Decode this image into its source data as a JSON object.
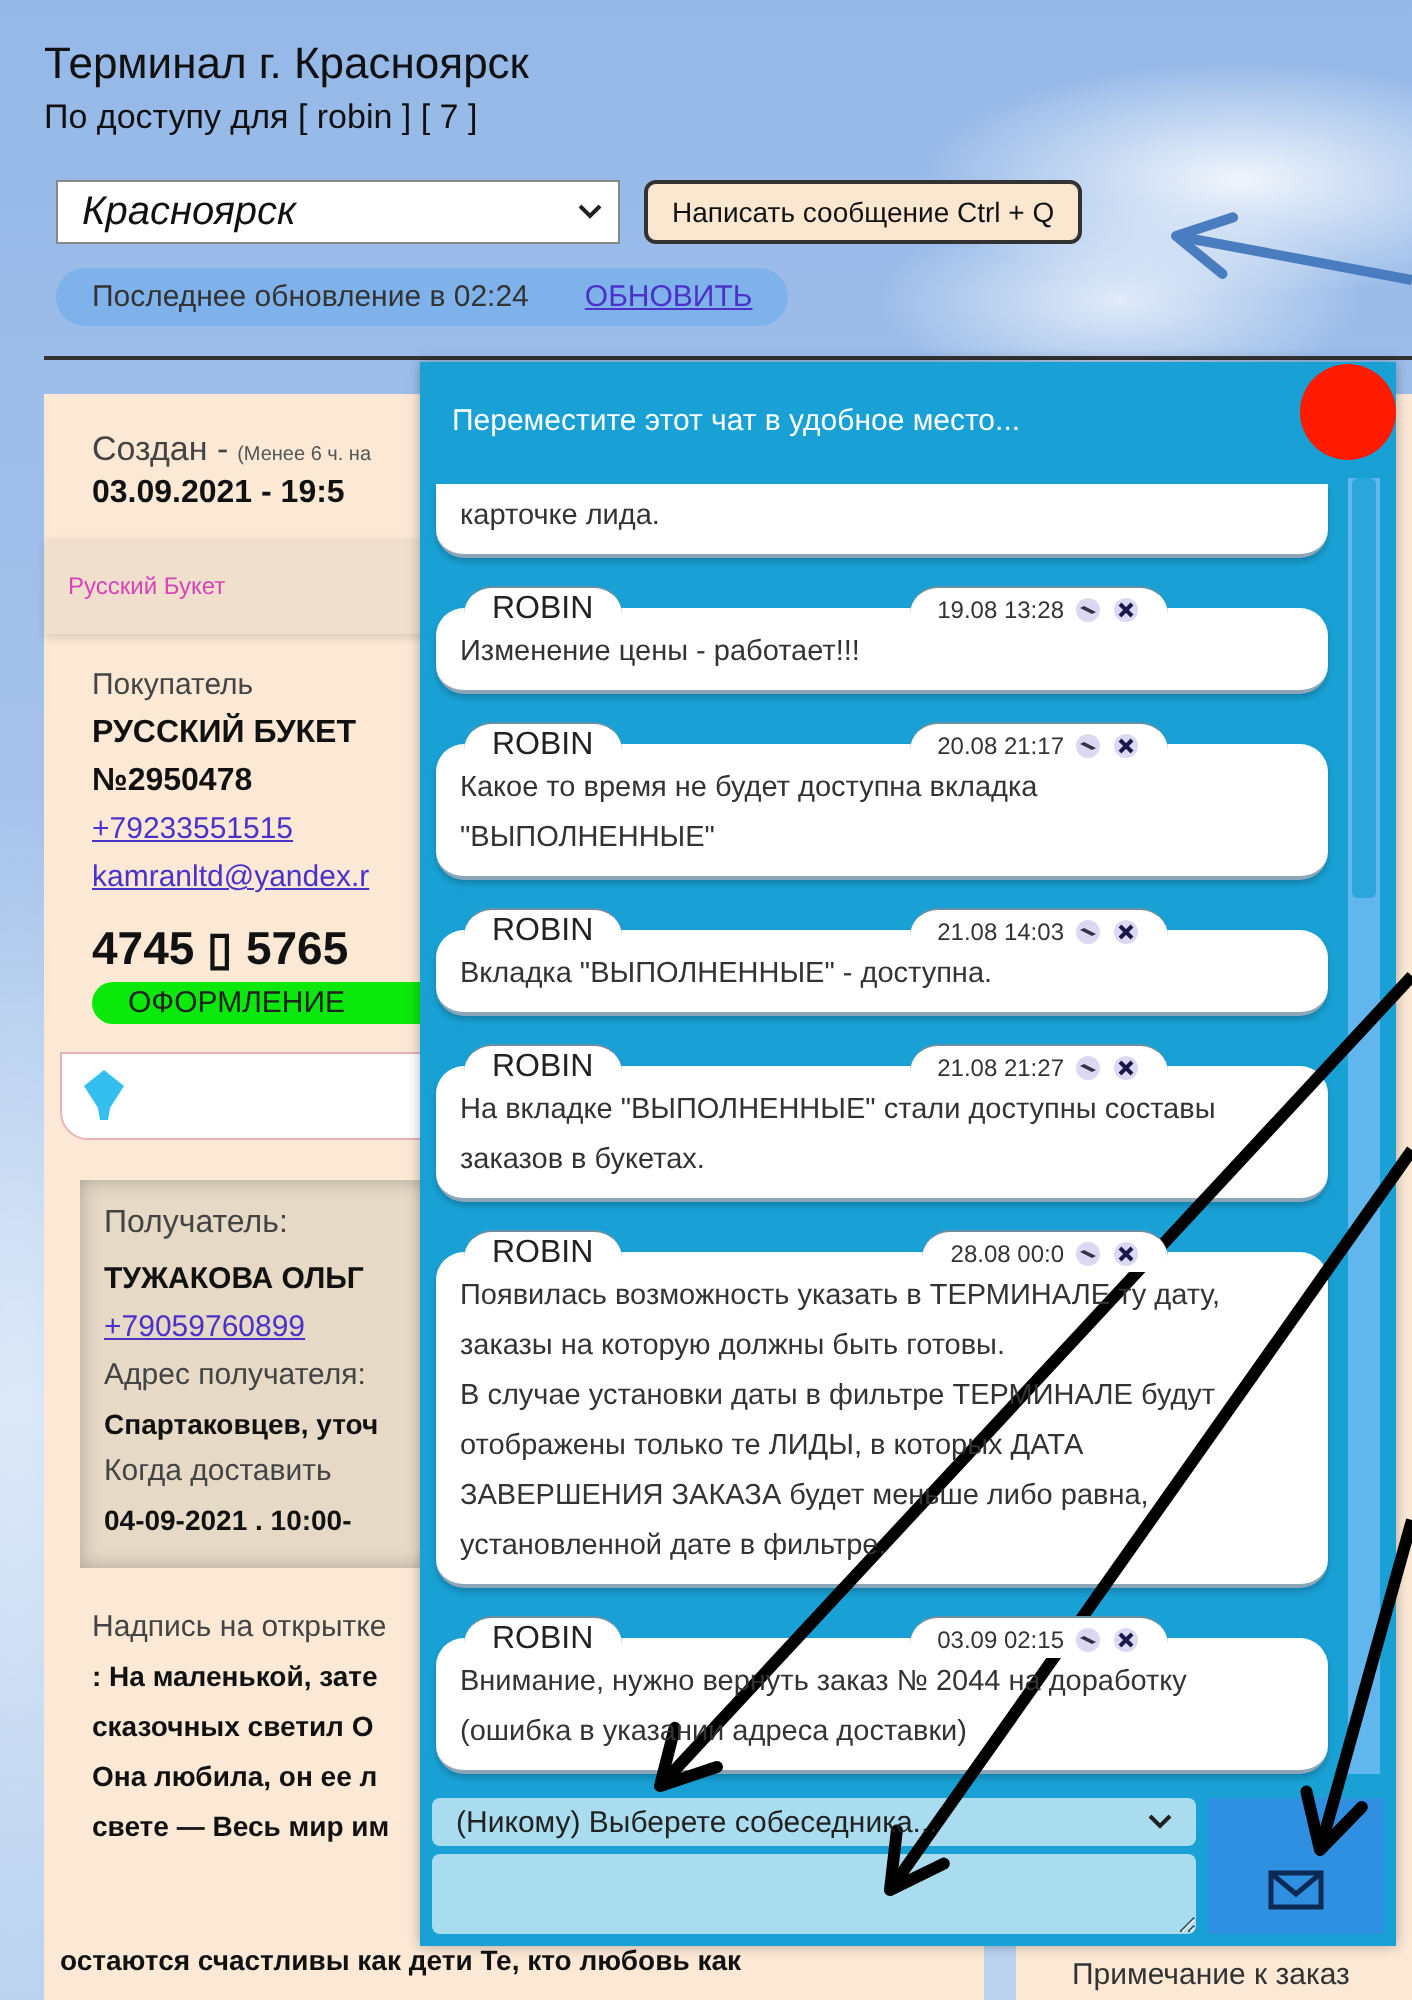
{
  "header": {
    "title": "Терминал г. Красноярск",
    "subtitle": "По доступу для [ robin ] [ 7 ]",
    "city_select": {
      "value": "Красноярск"
    },
    "compose_button": "Написать сообщение Ctrl + Q",
    "update_status": "Последнее обновление в 02:24",
    "refresh_link": "ОБНОВИТЬ"
  },
  "order_card": {
    "created_label": "Создан -",
    "created_note": "(Менее 6 ч. на",
    "created_date": "03.09.2021 - 19:5",
    "shop": "Русский Букет",
    "buyer_label": "Покупатель",
    "buyer_name": "РУССКИЙ БУКЕТ",
    "buyer_number": "№2950478",
    "buyer_phone": "+79233551515",
    "buyer_email": "kamranltd@yandex.r",
    "price": "4745 ▯ 5765",
    "status": "ОФОРМЛЕНИЕ",
    "recipient": {
      "label": "Получатель:",
      "name": "ТУЖАКОВА ОЛЬГ",
      "phone": "+79059760899",
      "address_label": "Адрес получателя:",
      "address": "Спартаковцев, уточ",
      "when_label": "Когда доставить",
      "when": "04-09-2021 . 10:00-"
    },
    "card_text_label": "Надпись на открытке",
    "card_text_lines": [
      ": На маленькой, зате",
      "сказочных светил О",
      "Она любила, он ее л",
      "свете — Весь мир им"
    ],
    "card_text_last": "остаются счастливы как дети Те, кто любовь как"
  },
  "right_card": {
    "note_label": "Примечание к заказ"
  },
  "chat": {
    "title": "Переместите этот чат в удобное место...",
    "messages": [
      {
        "text": "карточке лида."
      },
      {
        "author": "ROBIN",
        "time": "19.08 13:28",
        "text": "Изменение цены - работает!!!"
      },
      {
        "author": "ROBIN",
        "time": "20.08 21:17",
        "text": "Какое то время не будет доступна вкладка \"ВЫПОЛНЕННЫЕ\""
      },
      {
        "author": "ROBIN",
        "time": "21.08 14:03",
        "text": "Вкладка \"ВЫПОЛНЕННЫЕ\" - доступна."
      },
      {
        "author": "ROBIN",
        "time": "21.08 21:27",
        "text": "На вкладке \"ВЫПОЛНЕННЫЕ\" стали доступны составы заказов в букетах."
      },
      {
        "author": "ROBIN",
        "time": "28.08 00:0",
        "text": "Появилась возможность указать в ТЕРМИНАЛЕ ту дату, заказы на которую должны быть готовы.\nВ случае установки даты в фильтре ТЕРМИНАЛЕ будут отображены только те ЛИДЫ, в которых ДАТА ЗАВЕРШЕНИЯ ЗАКАЗА будет меньше либо равна, установленной дате в фильтре."
      },
      {
        "author": "ROBIN",
        "time": "03.09 02:15",
        "text": "Внимание, нужно вернуть заказ № 2044 на доработку (ошибка в указании адреса доставки)"
      }
    ],
    "recipient_select": {
      "value": "(Никому) Выберете собеседника..."
    }
  }
}
